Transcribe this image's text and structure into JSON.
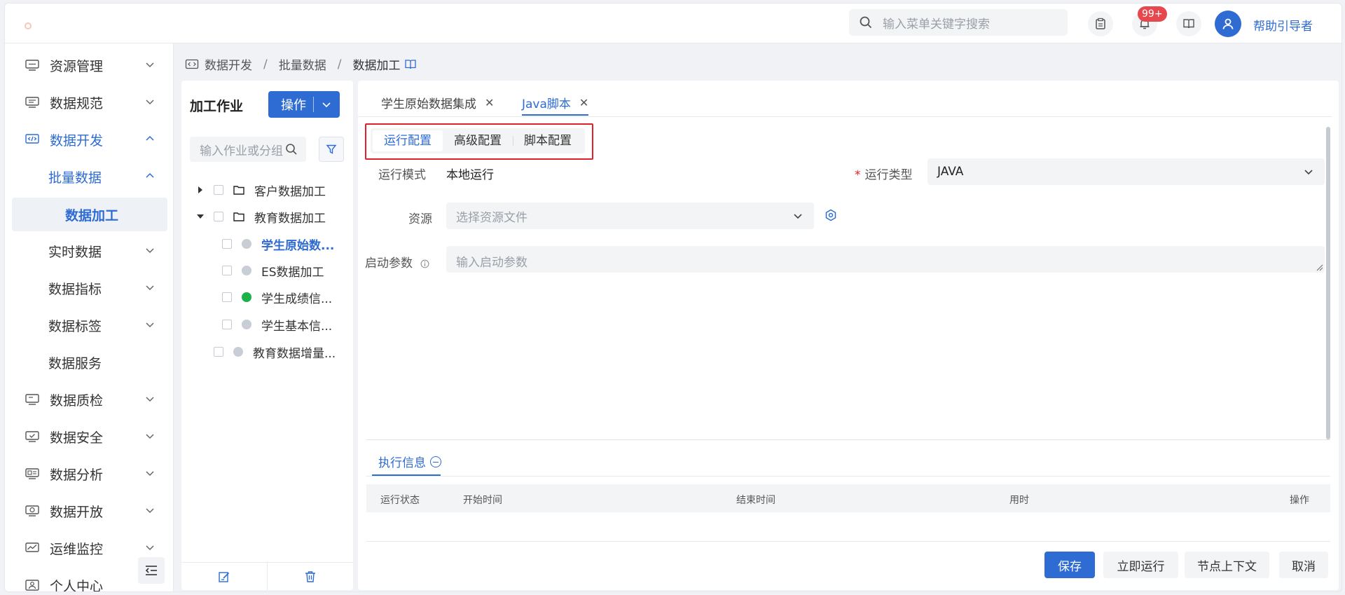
{
  "header": {
    "search_placeholder": "输入菜单关键字搜索",
    "notification_count": "99+",
    "username": "帮助引导者"
  },
  "sidebar": {
    "items": [
      {
        "label": "资源管理",
        "icon": "server-icon"
      },
      {
        "label": "数据规范",
        "icon": "document-icon"
      },
      {
        "label": "数据开发",
        "icon": "code-icon"
      },
      {
        "label": "批量数据"
      },
      {
        "label": "数据加工"
      },
      {
        "label": "实时数据"
      },
      {
        "label": "数据指标"
      },
      {
        "label": "数据标签"
      },
      {
        "label": "数据服务"
      },
      {
        "label": "数据质检",
        "icon": "monitor-icon"
      },
      {
        "label": "数据安全",
        "icon": "shield-check-icon"
      },
      {
        "label": "数据分析",
        "icon": "chart-icon"
      },
      {
        "label": "数据开放",
        "icon": "open-icon"
      },
      {
        "label": "运维监控",
        "icon": "line-chart-icon"
      },
      {
        "label": "个人中心",
        "icon": "user-icon"
      }
    ]
  },
  "breadcrumb": [
    "数据开发",
    "批量数据",
    "数据加工"
  ],
  "tree": {
    "title": "加工作业",
    "op_button": "操作",
    "search_placeholder": "输入作业或分组",
    "nodes": [
      {
        "label": "客户数据加工"
      },
      {
        "label": "教育数据加工"
      },
      {
        "label": "学生原始数..."
      },
      {
        "label": "ES数据加工"
      },
      {
        "label": "学生成绩信..."
      },
      {
        "label": "学生基本信..."
      },
      {
        "label": "教育数据增量..."
      }
    ]
  },
  "tabs": [
    {
      "label": "学生原始数据集成"
    },
    {
      "label": "Java脚本"
    }
  ],
  "config_tabs": [
    "运行配置",
    "高级配置",
    "脚本配置"
  ],
  "form": {
    "run_mode_label": "运行模式",
    "run_mode_value": "本地运行",
    "run_type_label": "运行类型",
    "run_type_value": "JAVA",
    "resource_label": "资源",
    "resource_placeholder": "选择资源文件",
    "params_label": "启动参数",
    "params_placeholder": "输入启动参数"
  },
  "exec": {
    "tab_label": "执行信息",
    "columns": [
      "运行状态",
      "开始时间",
      "结束时间",
      "用时",
      "操作"
    ]
  },
  "actions": {
    "save": "保存",
    "run_now": "立即运行",
    "node_context": "节点上下文",
    "cancel": "取消"
  },
  "colors": {
    "primary": "#2e6bd3",
    "highlight_box": "#e0202a",
    "status_green": "#19b34a"
  }
}
